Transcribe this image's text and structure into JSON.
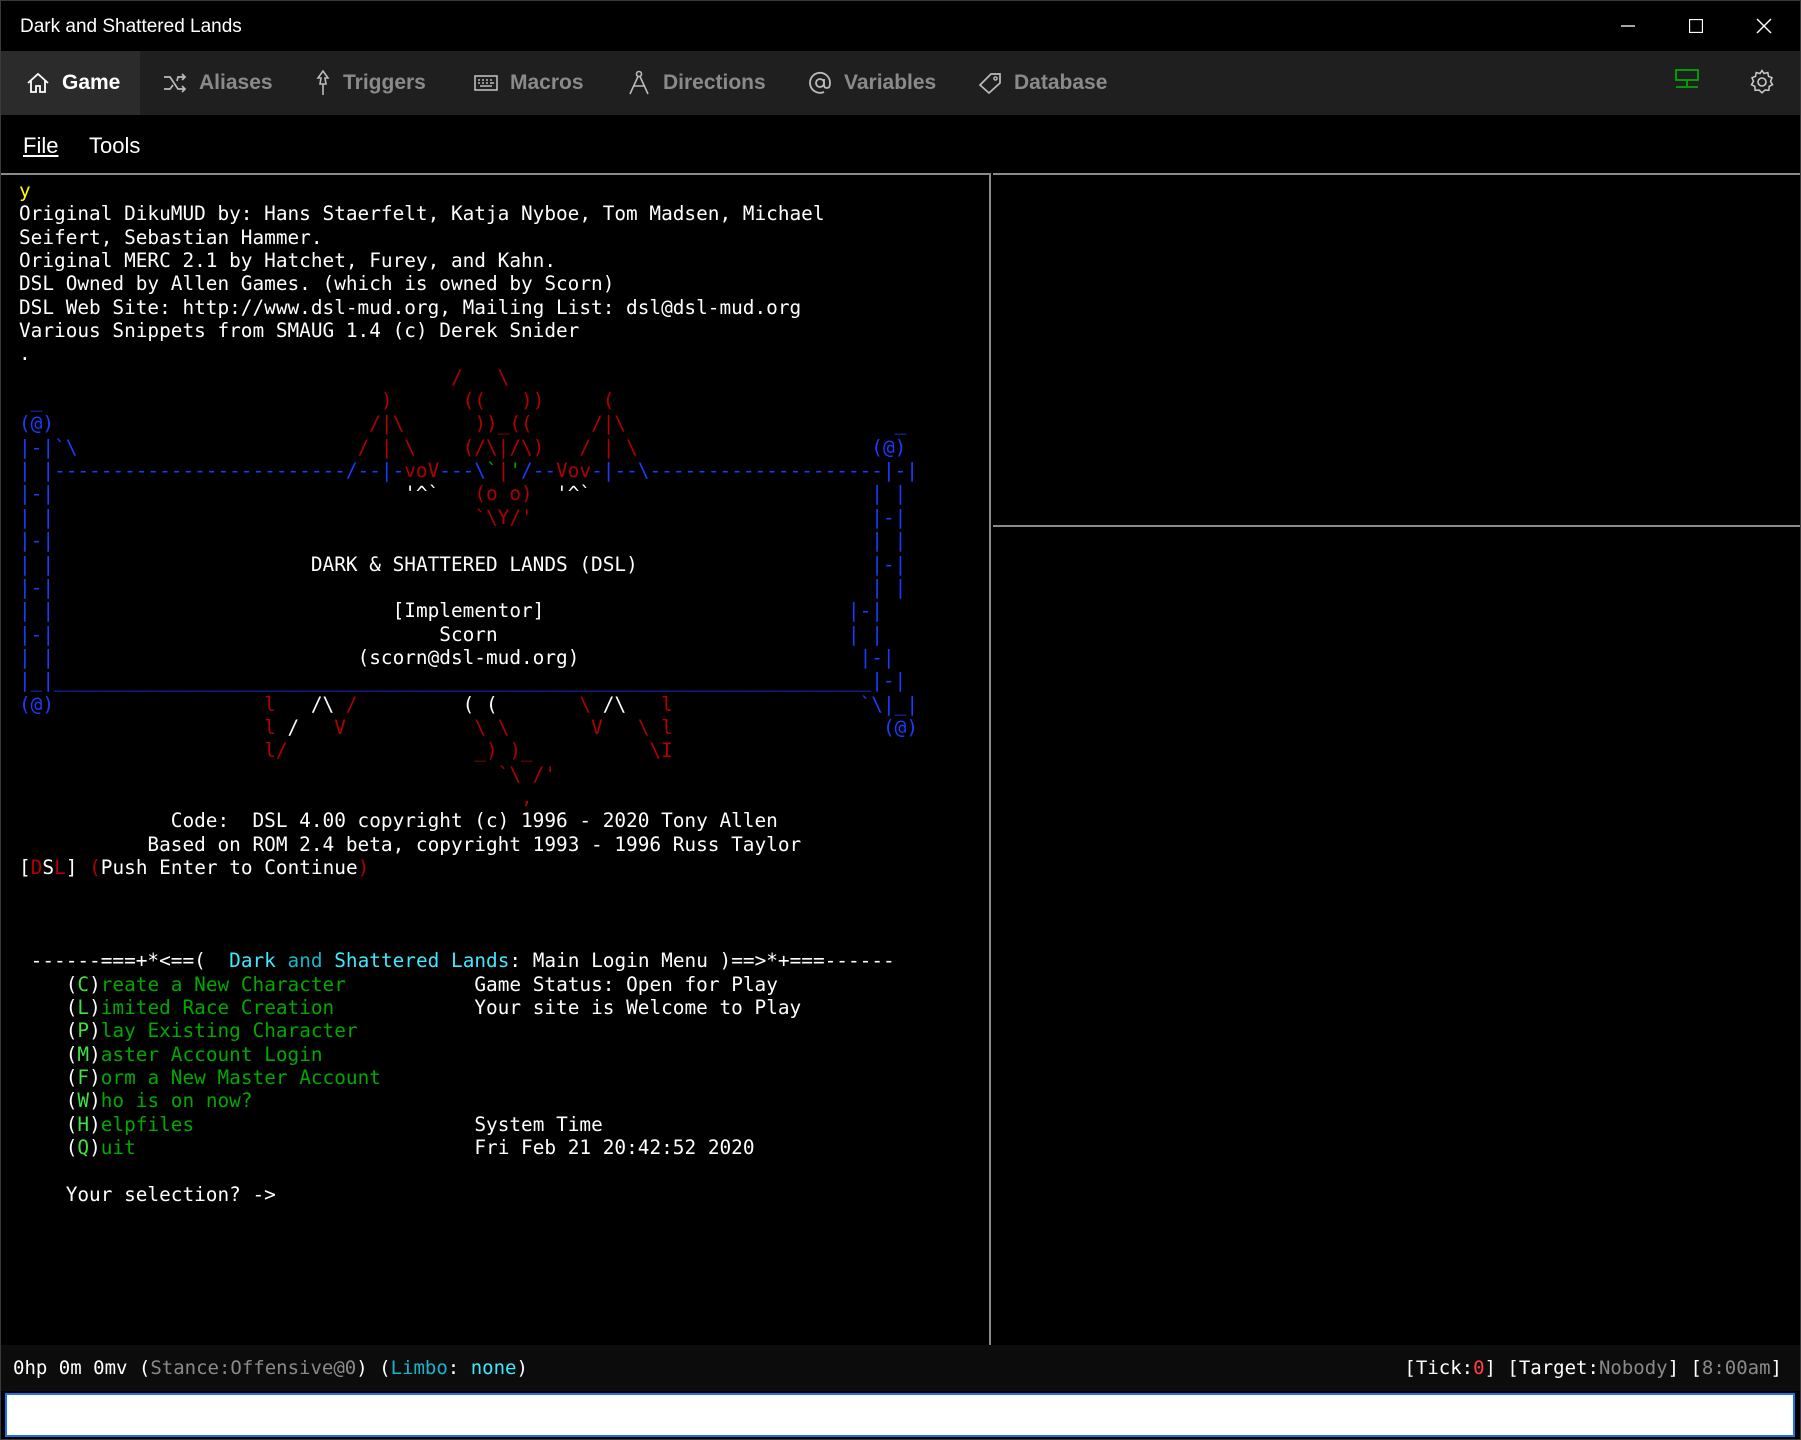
{
  "window": {
    "title": "Dark and Shattered Lands"
  },
  "tabs": [
    {
      "label": "Game",
      "icon": "home-icon",
      "active": true
    },
    {
      "label": "Aliases",
      "icon": "shuffle-icon"
    },
    {
      "label": "Triggers",
      "icon": "pin-icon"
    },
    {
      "label": "Macros",
      "icon": "keyboard-icon"
    },
    {
      "label": "Directions",
      "icon": "compass-icon"
    },
    {
      "label": "Variables",
      "icon": "at-icon"
    },
    {
      "label": "Database",
      "icon": "tag-icon"
    }
  ],
  "menu": {
    "file": "File",
    "tools": "Tools"
  },
  "terminal": {
    "line_y": "y",
    "credits": [
      "Original DikuMUD by: Hans Staerfelt, Katja Nyboe, Tom Madsen, Michael",
      "Seifert, Sebastian Hammer.",
      "Original MERC 2.1 by Hatchet, Furey, and Kahn.",
      "DSL Owned by Allen Games. (which is owned by Scorn)",
      "DSL Web Site: http://www.dsl-mud.org, Mailing List: dsl@dsl-mud.org",
      "Various Snippets from SMAUG 1.4 (c) Derek Snider",
      "."
    ],
    "banner_title": "DARK & SHATTERED LANDS (DSL)",
    "implementor_label": "[Implementor]",
    "implementor_name": "Scorn",
    "implementor_email": "(scorn@dsl-mud.org)",
    "code_line": "Code:  DSL 4.00 copyright (c) 1996 - 2020 Tony Allen",
    "rom_line": "Based on ROM 2.4 beta, copyright 1993 - 1996 Russ Taylor",
    "continue_prompt": "Push Enter to Continue",
    "menu_title_dark": "Dark",
    "menu_title_and": "and",
    "menu_title_shattered": "Shattered",
    "menu_title_lands": "Lands",
    "menu_title_rest": "Main Login Menu",
    "menu_items": [
      {
        "key": "C",
        "rest": "reate a New Character"
      },
      {
        "key": "L",
        "rest": "imited Race Creation"
      },
      {
        "key": "P",
        "rest": "lay Existing Character"
      },
      {
        "key": "M",
        "rest": "aster Account Login"
      },
      {
        "key": "F",
        "rest": "orm a New Master Account"
      },
      {
        "key": "W",
        "rest": "ho is on now?"
      },
      {
        "key": "H",
        "rest": "elpfiles"
      },
      {
        "key": "Q",
        "rest": "uit"
      }
    ],
    "game_status_label": "Game Status:",
    "game_status_value": "Open for Play",
    "site_label": "Your site is",
    "site_value": "Welcome to Play",
    "system_time_label": "System Time",
    "system_time_value": "Fri Feb 21 20:42:52 2020",
    "selection_prompt": "Your selection? ->"
  },
  "status": {
    "hp": "0hp",
    "mana": "0m",
    "mv": "0mv",
    "stance_label": "Stance:",
    "stance_value": "Offensive@0",
    "limbo_label": "Limbo",
    "limbo_value": "none",
    "tick_label": "Tick:",
    "tick_value": "0",
    "target_label": "Target:",
    "target_value": "Nobody",
    "clock": "8:00am"
  },
  "input": {
    "value": ""
  },
  "colors": {
    "accent": "#1a73e8",
    "tab_bar": "#1f1f1f",
    "connected": "#00a800"
  }
}
